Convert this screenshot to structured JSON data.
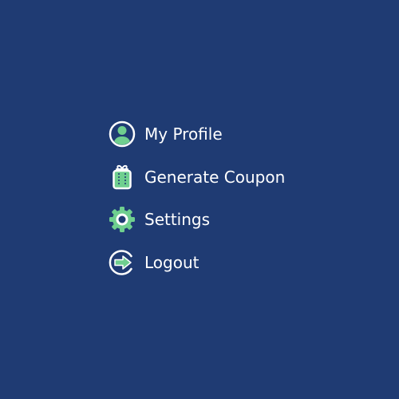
{
  "menu": {
    "items": [
      {
        "label": "My Profile",
        "icon": "user-profile-icon"
      },
      {
        "label": "Generate Coupon",
        "icon": "gift-coupon-icon"
      },
      {
        "label": "Settings",
        "icon": "gear-icon"
      },
      {
        "label": "Logout",
        "icon": "logout-arrow-icon"
      }
    ]
  },
  "colors": {
    "background": "#1f3b73",
    "text": "#ffffff",
    "icon_accent": "#6fcf8f",
    "icon_outline": "#ffffff",
    "icon_dark": "#1f3b73"
  }
}
